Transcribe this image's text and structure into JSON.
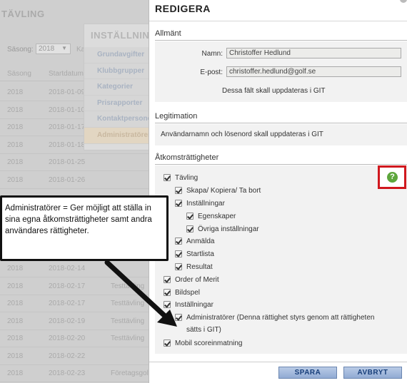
{
  "background": {
    "page_title": "TÄVLING",
    "season_label": "Säsong:",
    "season_value": "2018",
    "season_arrow": "▼",
    "trailing_label": "Ka",
    "columns": [
      "Säsong",
      "Startdatum"
    ],
    "rows": [
      {
        "season": "2018",
        "date": "2018-01-09",
        "name": ""
      },
      {
        "season": "2018",
        "date": "2018-01-10",
        "name": ""
      },
      {
        "season": "2018",
        "date": "2018-01-17",
        "name": ""
      },
      {
        "season": "2018",
        "date": "2018-01-18",
        "name": ""
      },
      {
        "season": "2018",
        "date": "2018-01-25",
        "name": ""
      },
      {
        "season": "2018",
        "date": "2018-01-26",
        "name": ""
      },
      {
        "season": "2018",
        "date": "2018-02-14",
        "name": ""
      },
      {
        "season": "2018",
        "date": "2018-02-17",
        "name": "Testtävling"
      },
      {
        "season": "2018",
        "date": "2018-02-17",
        "name": "Testtävling"
      },
      {
        "season": "2018",
        "date": "2018-02-19",
        "name": "Testtävling"
      },
      {
        "season": "2018",
        "date": "2018-02-20",
        "name": "Testtävling"
      },
      {
        "season": "2018",
        "date": "2018-02-22",
        "name": ""
      },
      {
        "season": "2018",
        "date": "2018-02-23",
        "name": "Företagsgolf"
      }
    ],
    "settings_title": "INSTÄLLNINGAR",
    "settings_menu": [
      "Grundavgifter",
      "Klubbgrupper",
      "Kategorier",
      "Prisrapporter",
      "Kontaktpersoner",
      "Administratörer"
    ]
  },
  "modal": {
    "title": "REDIGERA",
    "general": {
      "heading": "Allmänt",
      "name_label": "Namn:",
      "name_value": "Christoffer Hedlund",
      "email_label": "E-post:",
      "email_value": "christoffer.hedlund@golf.se",
      "note": "Dessa fält skall uppdateras i GIT"
    },
    "legitimation": {
      "heading": "Legitimation",
      "note": "Användarnamn och lösenord skall uppdateras i GIT"
    },
    "access": {
      "heading": "Åtkomsträttigheter",
      "help_glyph": "?",
      "items": [
        {
          "label": "Tävling",
          "checked": true
        },
        {
          "label": "Skapa/ Kopiera/ Ta bort",
          "checked": true
        },
        {
          "label": "Inställningar",
          "checked": true
        },
        {
          "label": "Egenskaper",
          "checked": true
        },
        {
          "label": "Övriga inställningar",
          "checked": true
        },
        {
          "label": "Anmälda",
          "checked": true
        },
        {
          "label": "Startlista",
          "checked": true
        },
        {
          "label": "Resultat",
          "checked": true
        },
        {
          "label": "Order of Merit",
          "checked": true
        },
        {
          "label": "Bildspel",
          "checked": true
        },
        {
          "label": "Inställningar",
          "checked": true
        },
        {
          "label": "Administratörer (Denna rättighet styrs genom att rättigheten sätts i GIT)",
          "checked": true
        },
        {
          "label": "Mobil scoreinmatning",
          "checked": true
        }
      ]
    },
    "buttons": {
      "save": "SPARA",
      "cancel": "AVBRYT"
    }
  },
  "callout": {
    "text": "Administratörer = Ger möjligt att ställa in sina egna åtkomsträttigheter samt andra användares rättigheter."
  },
  "colors": {
    "help_border": "#d0181e",
    "help_icon": "#5da63c",
    "button_text": "#173e7a"
  }
}
